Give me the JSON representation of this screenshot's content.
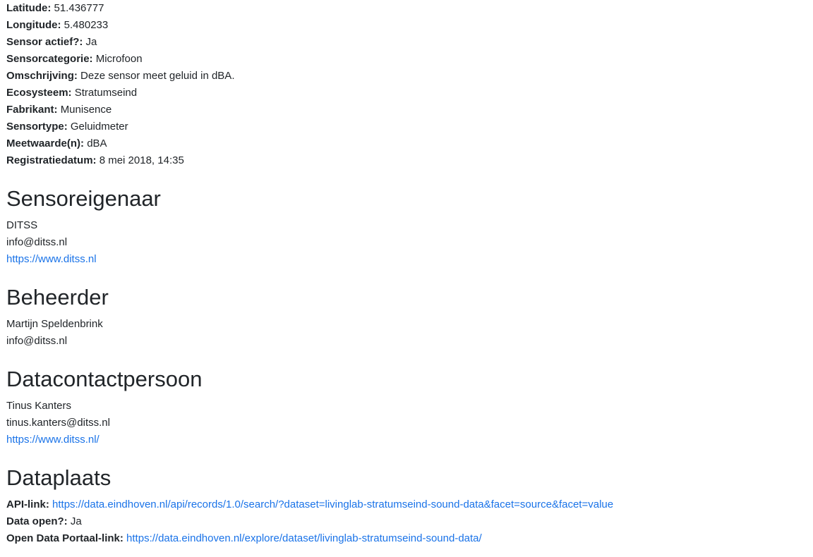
{
  "sensor_details": [
    {
      "label": "Latitude:",
      "value": "51.436777"
    },
    {
      "label": "Longitude:",
      "value": "5.480233"
    },
    {
      "label": "Sensor actief?:",
      "value": "Ja"
    },
    {
      "label": "Sensorcategorie:",
      "value": "Microfoon"
    },
    {
      "label": "Omschrijving:",
      "value": "Deze sensor meet geluid in dBA."
    },
    {
      "label": "Ecosysteem:",
      "value": "Stratumseind"
    },
    {
      "label": "Fabrikant:",
      "value": "Munisence"
    },
    {
      "label": "Sensortype:",
      "value": "Geluidmeter"
    },
    {
      "label": "Meetwaarde(n):",
      "value": "dBA"
    },
    {
      "label": "Registratiedatum:",
      "value": "8 mei 2018, 14:35"
    }
  ],
  "owner": {
    "heading": "Sensoreigenaar",
    "name": "DITSS",
    "email": "info@ditss.nl",
    "website": "https://www.ditss.nl"
  },
  "manager": {
    "heading": "Beheerder",
    "name": "Martijn Speldenbrink",
    "email": "info@ditss.nl"
  },
  "data_contact": {
    "heading": "Datacontactpersoon",
    "name": "Tinus Kanters",
    "email": "tinus.kanters@ditss.nl",
    "website": "https://www.ditss.nl/"
  },
  "data_location": {
    "heading": "Dataplaats",
    "api_label": "API-link:",
    "api_url": "https://data.eindhoven.nl/api/records/1.0/search/?dataset=livinglab-stratumseind-sound-data&facet=source&facet=value",
    "open_label": "Data open?:",
    "open_value": "Ja",
    "portal_label": "Open Data Portaal-link:",
    "portal_url": "https://data.eindhoven.nl/explore/dataset/livinglab-stratumseind-sound-data/"
  },
  "colors": {
    "text": "#212529",
    "link": "#1a73e8"
  }
}
